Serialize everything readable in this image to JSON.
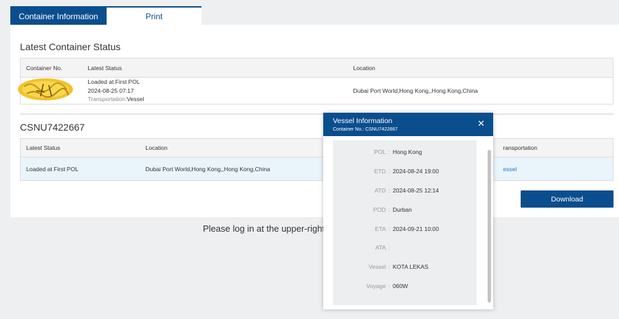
{
  "tabs": {
    "container_info": "Container Information",
    "print": "Print"
  },
  "latest": {
    "title": "Latest Container Status",
    "headers": [
      "Container No.",
      "Latest Status",
      "Location"
    ],
    "row": {
      "status": "Loaded at First POL",
      "datetime": "2024-08-25 07:17",
      "transport_label": "Transportation:",
      "transport_value": "Vessel",
      "location": "Dubai Port World,Hong Kong,,Hong Kong,China"
    }
  },
  "container": {
    "number": "CSNU7422667",
    "headers": [
      "Latest Status",
      "Location",
      "Transportation"
    ],
    "header_partial": "ransportation",
    "row": {
      "status": "Loaded at First POL",
      "location": "Dubai Port World,Hong Kong,,Hong Kong,China",
      "transport_partial": "essel"
    }
  },
  "download_label": "Download",
  "login_message": "Please log in at the upper-right c",
  "modal": {
    "title": "Vessel Information",
    "subtitle": "Container No.:  CSNU7422667",
    "close_icon": "close-icon",
    "fields": [
      {
        "key": "POL",
        "value": "Hong Kong"
      },
      {
        "key": "ETD",
        "value": "2024-08-24 19:00"
      },
      {
        "key": "ATD",
        "value": "2024-08-25 12:14"
      },
      {
        "key": "POD",
        "value": "Durban"
      },
      {
        "key": "ETA",
        "value": "2024-09-21 10:00"
      },
      {
        "key": "ATA",
        "value": ""
      },
      {
        "key": "Vessel",
        "value": "KOTA LEKAS"
      },
      {
        "key": "Voyage",
        "value": "060W"
      }
    ]
  },
  "colors": {
    "brand": "#0b4e8d",
    "link": "#1f79c9",
    "row_highlight": "#eaf4fb"
  }
}
